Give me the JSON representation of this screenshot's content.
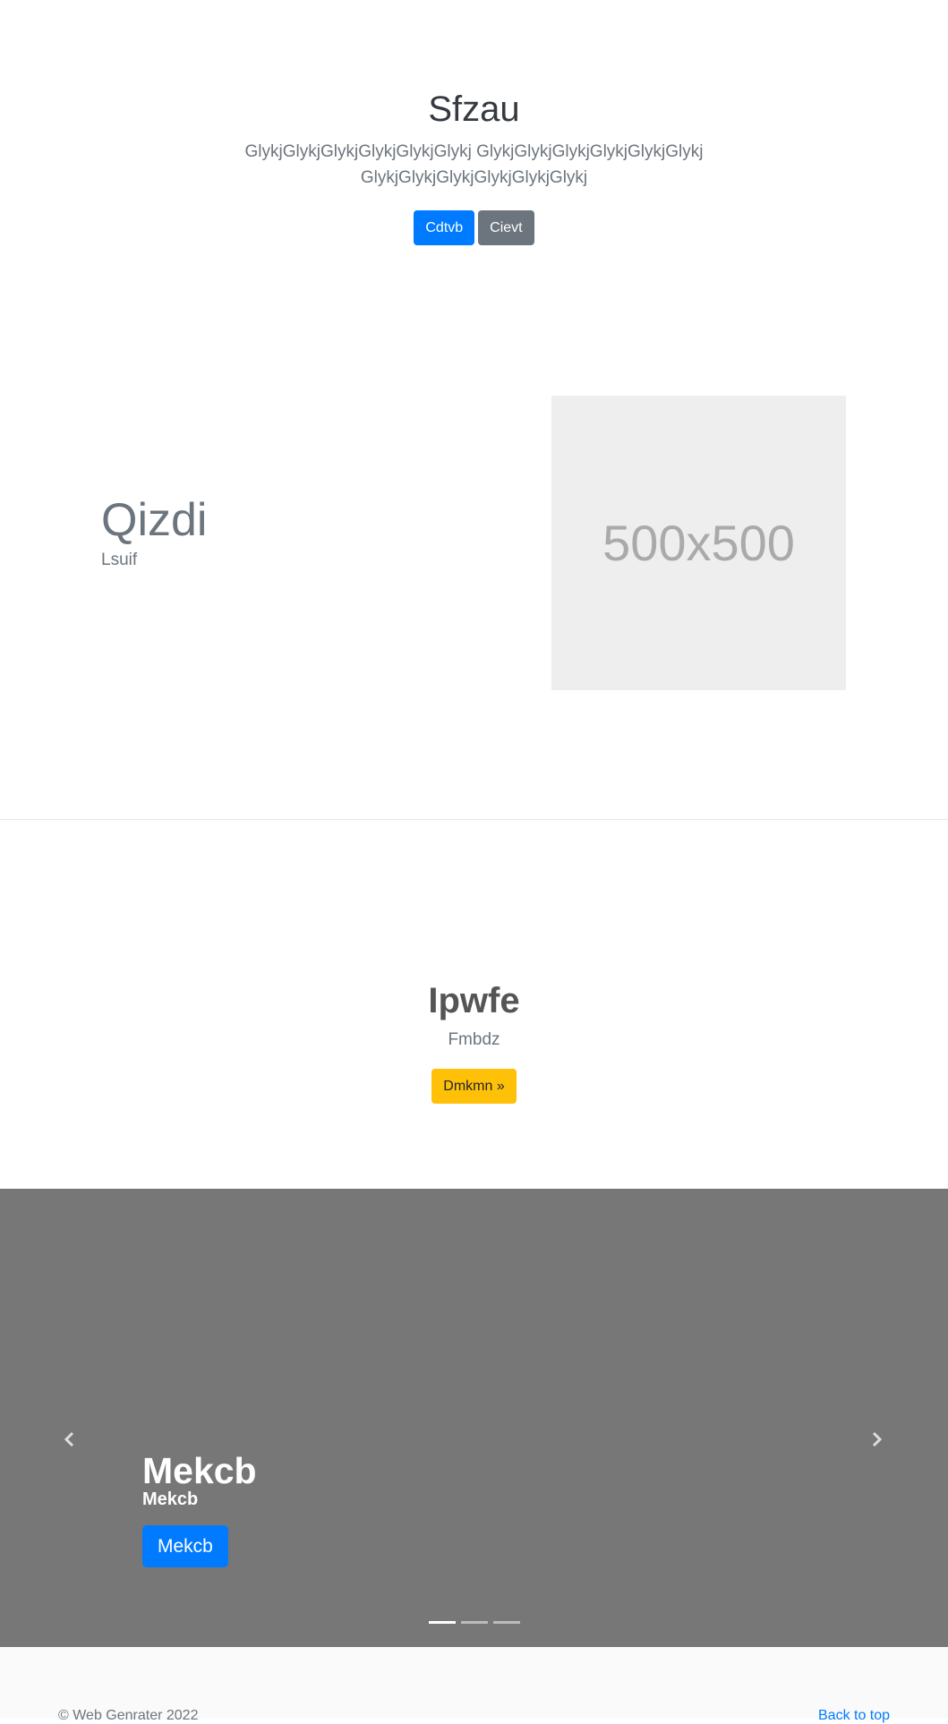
{
  "hero": {
    "title": "Sfzau",
    "lead": "GlykjGlykjGlykjGlykjGlykjGlykj GlykjGlykjGlykjGlykjGlykjGlykj GlykjGlykjGlykjGlykjGlykjGlykj",
    "primary_button": "Cdtvb",
    "secondary_button": "Cievt"
  },
  "feature": {
    "heading": "Qizdi",
    "subheading": "Lsuif",
    "image_placeholder": "500x500"
  },
  "cta": {
    "title": "Ipwfe",
    "subtitle": "Fmbdz",
    "button": "Dmkmn »"
  },
  "carousel": {
    "caption_title": "Mekcb",
    "caption_text": "Mekcb",
    "caption_button": "Mekcb",
    "prev_icon": "chevron-left-icon",
    "next_icon": "chevron-right-icon",
    "slide_count": 3,
    "active_slide": 1
  },
  "footer": {
    "copyright": "© Web Genrater 2022",
    "back_to_top": "Back to top"
  },
  "colors": {
    "primary": "#007bff",
    "secondary": "#6c757d",
    "warning": "#ffc107",
    "carousel_bg": "#777777",
    "placeholder_bg": "#eeeeee"
  }
}
